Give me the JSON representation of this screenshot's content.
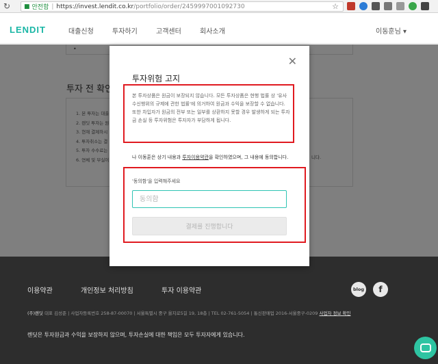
{
  "browser": {
    "secure_label": "안전함",
    "url_host": "https://invest.lendit.co.kr",
    "url_path": "/portfolio/order/2459997001092730"
  },
  "header": {
    "logo": "LENDIT",
    "nav": [
      "대출신청",
      "투자하기",
      "고객센터",
      "회사소개"
    ],
    "user": "이동훈님 ▾"
  },
  "page": {
    "section_title": "투자 전 확인",
    "checklist": [
      "1. 본 투자는 대출",
      "2. 렌딧 투자는 원",
      "3. 현재 결제하시",
      "4. 투자취소는 결",
      "5. 투자 수수료는",
      "6. 연체 및 부실이"
    ],
    "checklist_tail": "니다."
  },
  "modal": {
    "title": "투자위험 고지",
    "warning": "본 투자상품은 원금이 보장되지 않습니다. 모든 투자상품은 현행 법률 상 '유사수신행위의 규제에 관한 법률'에 의거하여 원금과 수익을 보장할 수 없습니다. 또한 차입자가 원금의 전부 또는 일부를 상환하지 못할 경우 발생하게 되는 투자금 손실 등 투자위험은 투자자가 부담하게 됩니다.",
    "agree_prefix": "나 이동훈은 상기 내용과 ",
    "agree_link": "투자이용약관",
    "agree_suffix": "을 확인하였으며, 그 내용에 동의합니다.",
    "input_label": "'동의함'을 입력해주세요",
    "input_placeholder": "동의함",
    "submit_label": "결제를 진행합니다",
    "close_glyph": "✕"
  },
  "footer": {
    "links": [
      "이용약관",
      "개인정보 처리방침",
      "투자 이용약관"
    ],
    "blog_label": "blog",
    "facebook_label": "f",
    "company": "(주)렌딧",
    "info": " 대표 김성준 | 사업자등록번호 258-87-00070 | 서울특별시 중구 을지로5길 19, 18층 | TEL 02-761-5054 | 통신판매업 2016-서울중구-0209 ",
    "info_link": "사업자 정보 확인",
    "disclaimer": "렌딧은 투자원금과 수익을 보장하지 않으며, 투자손실에 대한 책임은 모두 투자자에게 있습니다."
  },
  "colors": {
    "brand": "#19b6a5",
    "highlight": "#e0191f",
    "footer_bg": "#2d2d2d"
  }
}
